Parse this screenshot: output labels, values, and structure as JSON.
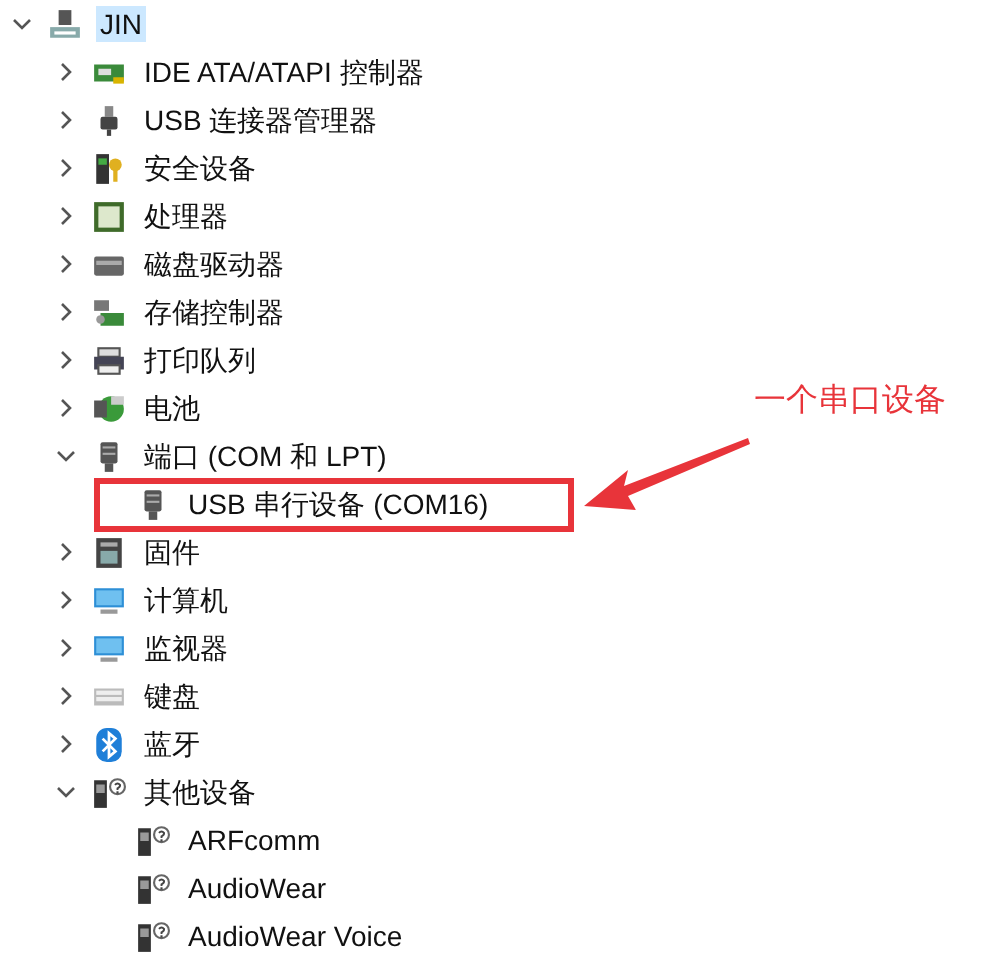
{
  "tree": {
    "label": "JIN",
    "kind": "pc",
    "expanded": true,
    "selected": true,
    "children": [
      {
        "label": "IDE ATA/ATAPI 控制器",
        "kind": "ide",
        "expanded": false,
        "selected": false
      },
      {
        "label": "USB 连接器管理器",
        "kind": "usb",
        "expanded": false,
        "selected": false
      },
      {
        "label": "安全设备",
        "kind": "security",
        "expanded": false,
        "selected": false
      },
      {
        "label": "处理器",
        "kind": "cpu",
        "expanded": false,
        "selected": false
      },
      {
        "label": "磁盘驱动器",
        "kind": "disk",
        "expanded": false,
        "selected": false
      },
      {
        "label": "存储控制器",
        "kind": "storage",
        "expanded": false,
        "selected": false
      },
      {
        "label": "打印队列",
        "kind": "printer",
        "expanded": false,
        "selected": false
      },
      {
        "label": "电池",
        "kind": "battery",
        "expanded": false,
        "selected": false
      },
      {
        "label": "端口 (COM 和 LPT)",
        "kind": "port",
        "expanded": true,
        "selected": false,
        "children": [
          {
            "label": "USB 串行设备 (COM16)",
            "kind": "port",
            "selected": false
          }
        ]
      },
      {
        "label": "固件",
        "kind": "firmware",
        "expanded": false,
        "selected": false
      },
      {
        "label": "计算机",
        "kind": "monitor",
        "expanded": false,
        "selected": false
      },
      {
        "label": "监视器",
        "kind": "monitor",
        "expanded": false,
        "selected": false
      },
      {
        "label": "键盘",
        "kind": "keyboard",
        "expanded": false,
        "selected": false
      },
      {
        "label": "蓝牙",
        "kind": "bluetooth",
        "expanded": false,
        "selected": false
      },
      {
        "label": "其他设备",
        "kind": "unknown",
        "expanded": true,
        "selected": false,
        "children": [
          {
            "label": "ARFcomm",
            "kind": "unknown",
            "selected": false
          },
          {
            "label": "AudioWear",
            "kind": "unknown",
            "selected": false
          },
          {
            "label": "AudioWear Voice",
            "kind": "unknown",
            "selected": false
          }
        ]
      }
    ]
  },
  "annotation": {
    "label": "一个串口设备"
  }
}
